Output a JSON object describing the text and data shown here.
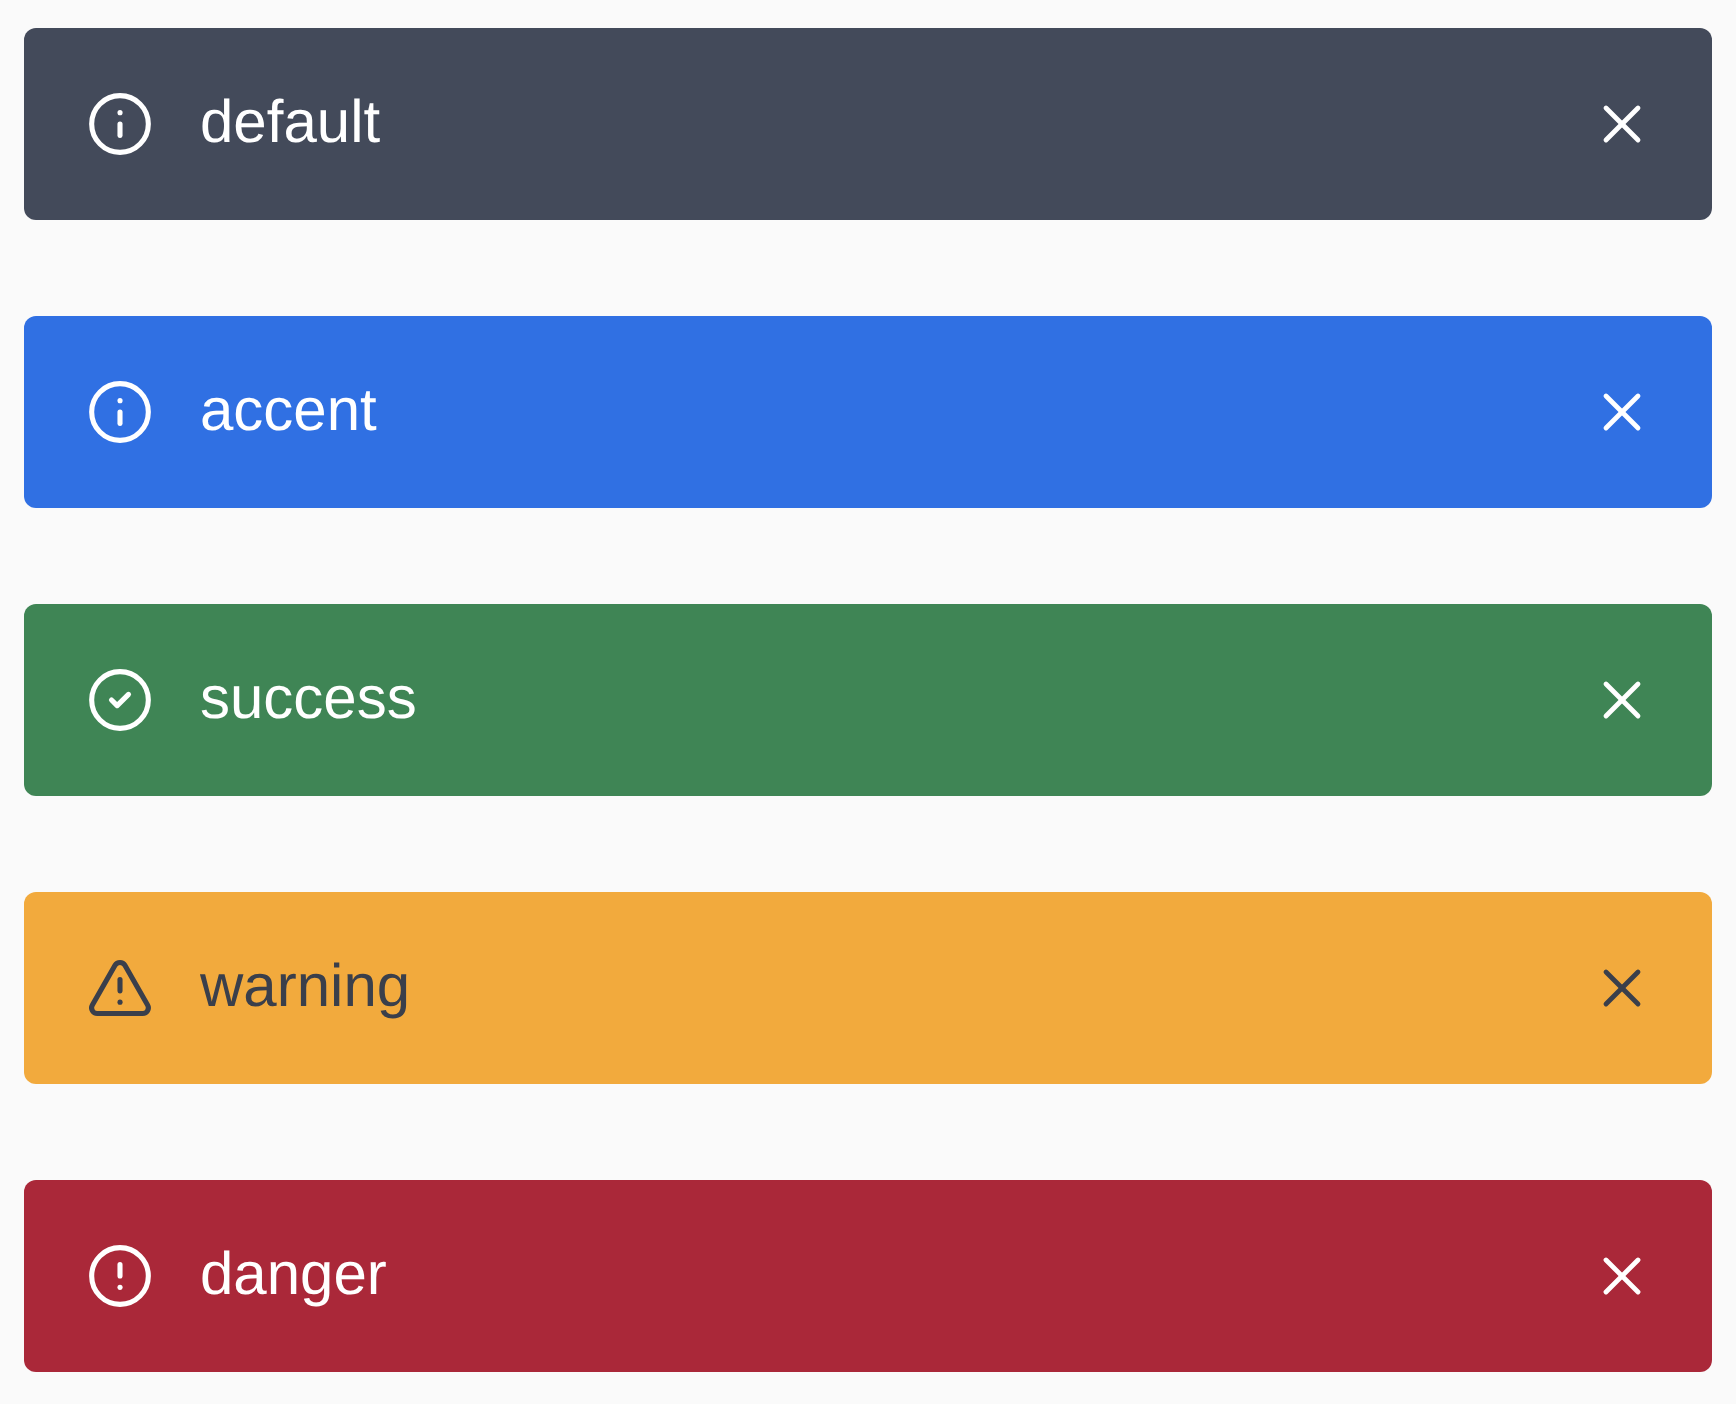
{
  "alerts": [
    {
      "kind": "info",
      "label": "default",
      "color": "#434a5a",
      "dark_text": false
    },
    {
      "kind": "info",
      "label": "accent",
      "color": "#3070e3",
      "dark_text": false
    },
    {
      "kind": "success",
      "label": "success",
      "color": "#3f8555",
      "dark_text": false
    },
    {
      "kind": "warning",
      "label": "warning",
      "color": "#f2aa3d",
      "dark_text": true
    },
    {
      "kind": "danger",
      "label": "danger",
      "color": "#aa2839",
      "dark_text": false
    }
  ]
}
